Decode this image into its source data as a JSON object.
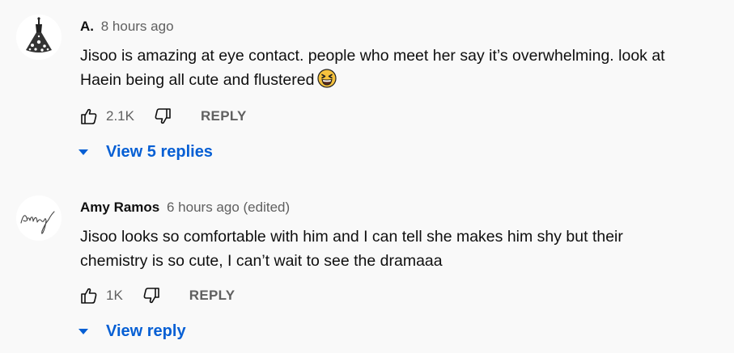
{
  "comments": [
    {
      "author": "A.",
      "time": "8 hours ago",
      "text_line1": "Jisoo is amazing at eye contact. people who meet her say it’s overwhelming. look at",
      "text_line2": "Haein being all cute and flustered",
      "emoji": "grinning-squinting-face",
      "likes": "2.1K",
      "reply_label": "REPLY",
      "view_replies": "View 5 replies"
    },
    {
      "author": "Amy Ramos",
      "time": "6 hours ago (edited)",
      "text_line1": "Jisoo looks so comfortable with him and I can tell she makes him shy but their",
      "text_line2": "chemistry is so cute, I can’t wait to see the dramaaa",
      "likes": "1K",
      "reply_label": "REPLY",
      "view_replies": "View reply"
    }
  ],
  "colors": {
    "background": "#f9f9f9",
    "link": "#065fd4",
    "secondary_text": "#606060"
  }
}
